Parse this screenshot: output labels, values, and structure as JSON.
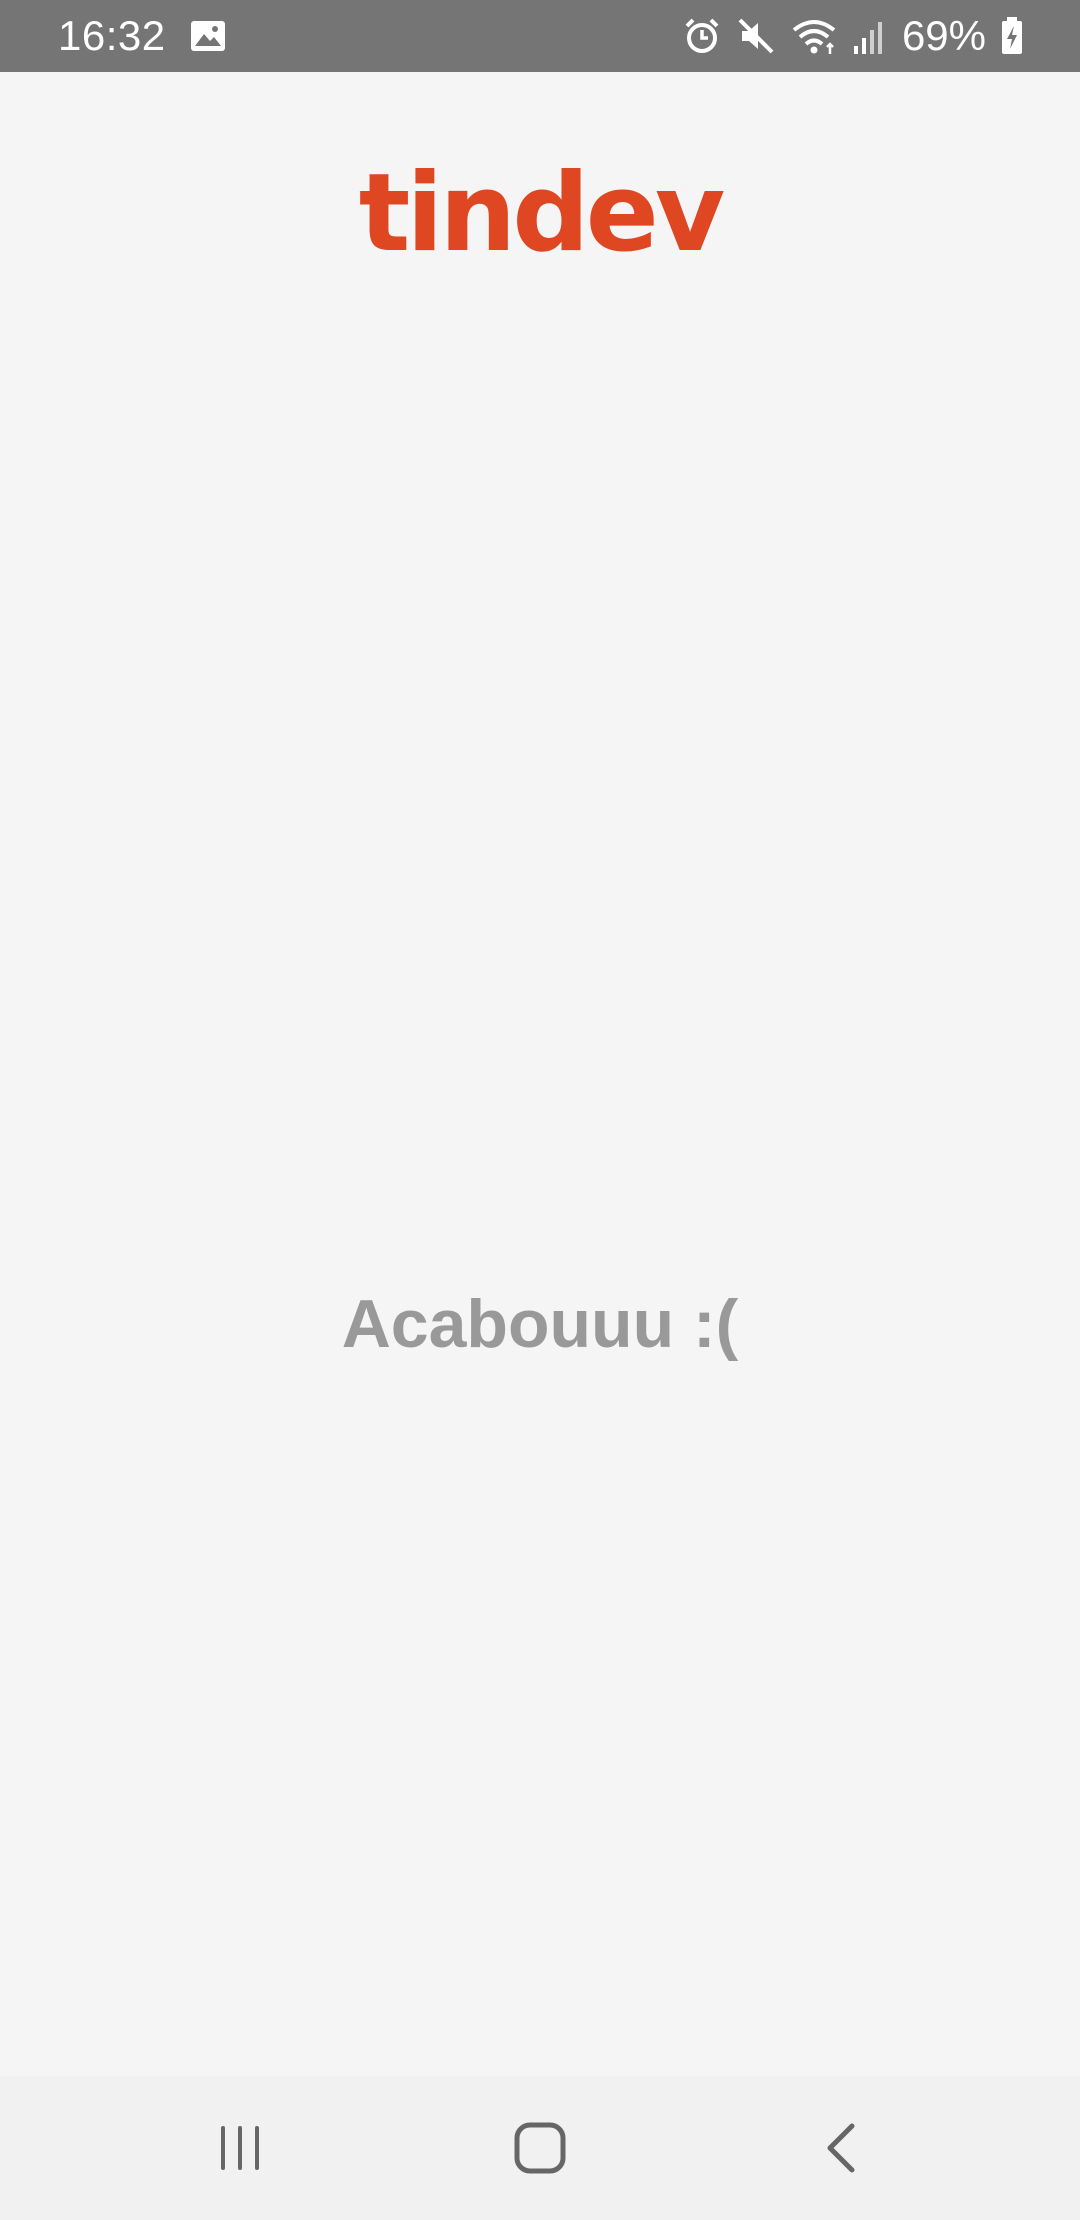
{
  "status_bar": {
    "time": "16:32",
    "battery_percent": "69%",
    "icons": [
      "image-icon",
      "alarm-icon",
      "mute-icon",
      "wifi-icon",
      "signal-icon",
      "battery-charging-icon"
    ]
  },
  "app": {
    "logo_text": "tindev",
    "brand_color": "#df4723"
  },
  "main": {
    "empty_message": "Acabouuu :("
  },
  "nav_bar": {
    "buttons": [
      "recent-apps-icon",
      "home-icon",
      "back-icon"
    ]
  }
}
